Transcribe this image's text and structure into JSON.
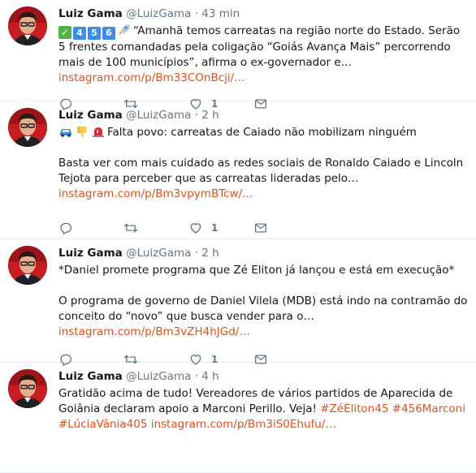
{
  "tweets": [
    {
      "name": "Luiz Gama",
      "handle": "@LuizGama",
      "dot": "·",
      "time": "43 min",
      "emoji_check": "✓",
      "emoji_keys": [
        "4",
        "5",
        "6"
      ],
      "text1": "“Amanhã temos carreatas na região norte do Estado. Serão 5 frentes comandadas pela coligação “Goiás Avança Mais” percorrendo mais de 100 municípios”, afirma o ex-governador e… ",
      "link": "instagram.com/p/Bm33COnBcji/…",
      "like_count": "1"
    },
    {
      "name": "Luiz Gama",
      "handle": "@LuizGama",
      "dot": "·",
      "time": "2 h",
      "line1": "Falta povo: carreatas de Caiado não mobilizam ninguém",
      "text2": "Basta ver com mais cuidado as redes sociais de Ronaldo Caiado e Lincoln Tejota para perceber que as carreatas lideradas pelo… ",
      "link": "instagram.com/p/Bm3vpymBTcw/…",
      "like_count": "1"
    },
    {
      "name": "Luiz Gama",
      "handle": "@LuizGama",
      "dot": "·",
      "time": "2 h",
      "line1": "*Daniel promete programa que Zé Eliton já lançou e está em execução*",
      "text2": "O programa de governo de Daniel Vilela (MDB) está indo na contramão do conceito do “novo” que busca vender para o… ",
      "link": "instagram.com/p/Bm3vZH4hJGd/…",
      "like_count": "1"
    },
    {
      "name": "Luiz Gama",
      "handle": "@LuizGama",
      "dot": "·",
      "time": "4 h",
      "text1": "Gratidão acima de tudo! Vereadores de vários partidos de Aparecida de Goiânia declaram apoio a Marconi Perillo. Veja! ",
      "hashtags": [
        "#ZéEliton45",
        "#456Marconi",
        "#LúciaVânia405"
      ],
      "link": "instagram.com/p/Bm3iS0Ehufu/…"
    }
  ],
  "icons": {
    "reply": "reply-icon",
    "retweet": "retweet-icon",
    "like": "heart-icon",
    "dm": "envelope-icon"
  },
  "colors": {
    "link": "#e0501c",
    "muted": "#657786",
    "divider": "#e6ecf0"
  }
}
